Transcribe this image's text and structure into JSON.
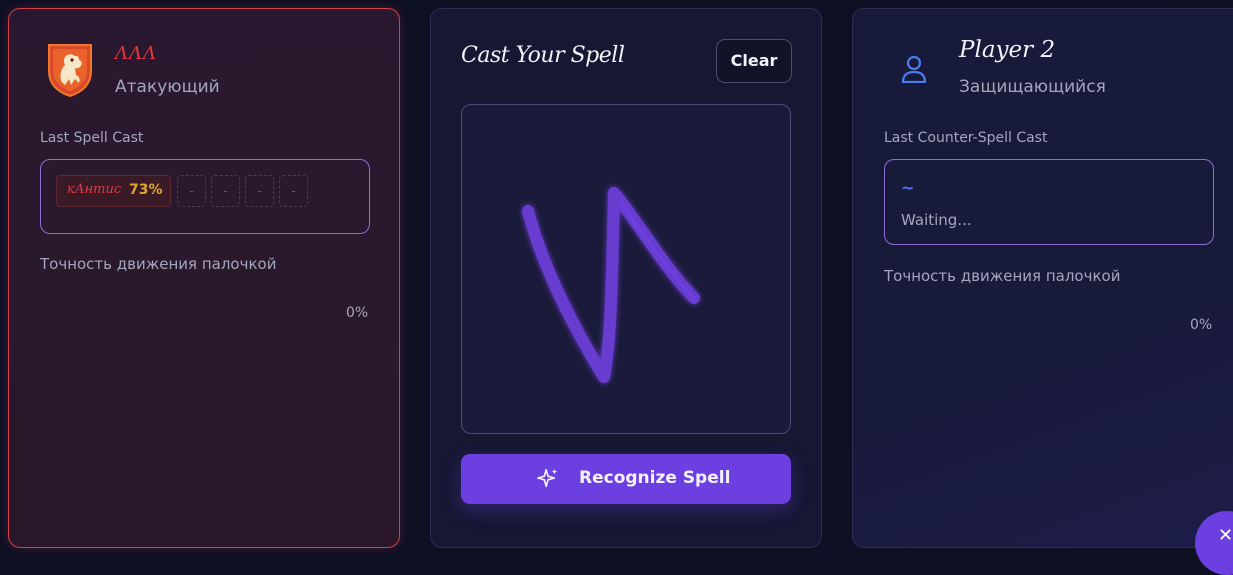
{
  "attacker": {
    "name": "ΛΛΛ",
    "role": "Атакующий",
    "last_spell_label": "Last Spell Cast",
    "spell": {
      "name": "кАнтис",
      "accuracy": "73%"
    },
    "empty_slots": [
      "-",
      "-",
      "-",
      "-"
    ],
    "wand_accuracy_label": "Точность движения палочкой",
    "wand_accuracy_value": "0%",
    "icon": "lion-crest-icon"
  },
  "center": {
    "title": "Cast Your Spell",
    "clear_label": "Clear",
    "recognize_label": "Recognize Spell",
    "recognize_icon": "sparkle-icon"
  },
  "defender": {
    "name": "Player 2",
    "role": "Защищающийся",
    "last_counter_label": "Last Counter-Spell Cast",
    "counter_glyph": "~",
    "status": "Waiting...",
    "wand_accuracy_label": "Точность движения палочкой",
    "wand_accuracy_value": "0%",
    "icon": "user-icon"
  },
  "colors": {
    "accent": "#6c3fe0",
    "attacker_border": "#d2404e",
    "attacker_name": "#e5393f",
    "accuracy": "#e3a42c",
    "defender_icon": "#4a7bf0"
  }
}
